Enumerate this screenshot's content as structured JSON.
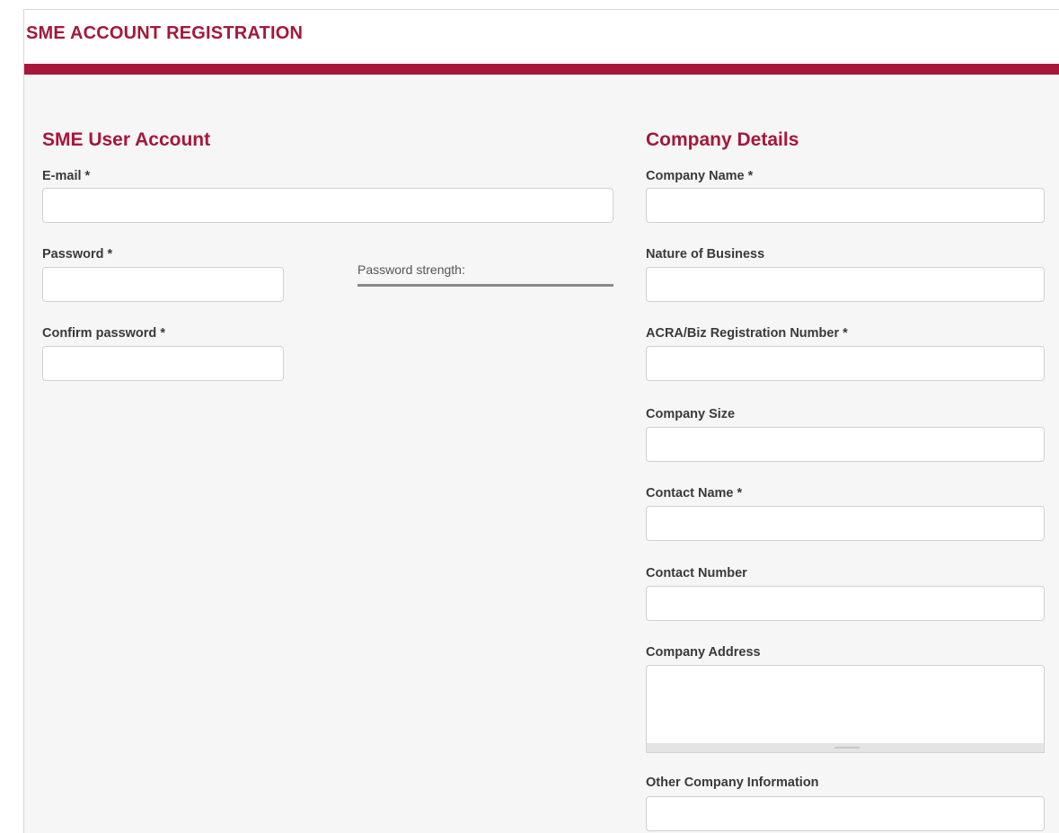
{
  "header": {
    "title": "SME ACCOUNT REGISTRATION"
  },
  "theme": {
    "accent_color": "#a6173a",
    "panel_bg": "#f6f6f6"
  },
  "user_account": {
    "heading": "SME User Account",
    "email": {
      "label": "E-mail *",
      "value": ""
    },
    "password": {
      "label": "Password *",
      "value": ""
    },
    "password_strength_label": "Password strength:",
    "confirm_password": {
      "label": "Confirm password *",
      "value": ""
    }
  },
  "company_details": {
    "heading": "Company Details",
    "company_name": {
      "label": "Company Name *",
      "value": ""
    },
    "nature_of_business": {
      "label": "Nature of Business",
      "value": ""
    },
    "registration_number": {
      "label": "ACRA/Biz Registration Number *",
      "value": ""
    },
    "company_size": {
      "label": "Company Size",
      "value": ""
    },
    "contact_name": {
      "label": "Contact Name *",
      "value": ""
    },
    "contact_number": {
      "label": "Contact Number",
      "value": ""
    },
    "company_address": {
      "label": "Company Address",
      "value": ""
    },
    "other_info": {
      "label": "Other Company Information",
      "value": ""
    }
  }
}
